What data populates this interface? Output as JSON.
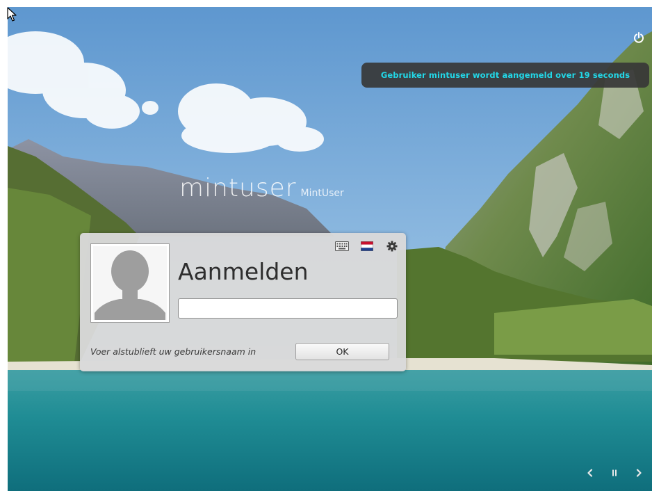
{
  "notification": {
    "text": "Gebruiker mintuser wordt aangemeld over 19 seconds"
  },
  "host": {
    "username": "mintuser",
    "realname": "MintUser"
  },
  "login": {
    "title": "Aanmelden",
    "input_value": "",
    "hint": "Voer alstublieft uw gebruikersnaam in",
    "ok_label": "OK"
  },
  "icons": {
    "power": "power-icon",
    "keyboard": "keyboard-icon",
    "flag": "netherlands-flag-icon",
    "settings": "gear-icon",
    "previous": "chevron-left-icon",
    "pause": "pause-icon",
    "next": "chevron-right-icon"
  },
  "colors": {
    "notification_text": "#22d8e8",
    "notification_bg": "#373737"
  }
}
